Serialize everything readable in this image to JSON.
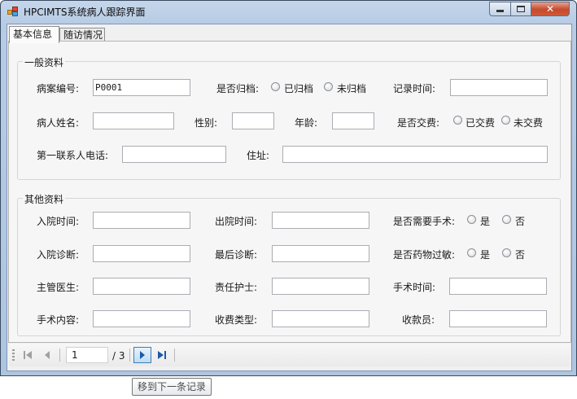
{
  "window": {
    "title": "HPCIMTS系统病人跟踪界面",
    "close_glyph": "✕"
  },
  "tabs": [
    {
      "label": "基本信息",
      "active": true
    },
    {
      "label": "随访情况",
      "active": false
    }
  ],
  "general": {
    "title": "一般资料",
    "case_no_label": "病案编号:",
    "case_no_value": "P0001",
    "archived_label": "是否归档:",
    "archived_yes": "已归档",
    "archived_no": "未归档",
    "record_time_label": "记录时间:",
    "patient_name_label": "病人姓名:",
    "gender_label": "性别:",
    "age_label": "年龄:",
    "paid_label": "是否交费:",
    "paid_yes": "已交费",
    "paid_no": "未交费",
    "contact_phone_label": "第一联系人电话:",
    "address_label": "住址:"
  },
  "other": {
    "title": "其他资料",
    "admission_time_label": "入院时间:",
    "discharge_time_label": "出院时间:",
    "surgery_needed_label": "是否需要手术:",
    "surgery_yes": "是",
    "surgery_no": "否",
    "admission_diag_label": "入院诊断:",
    "final_diag_label": "最后诊断:",
    "allergy_label": "是否药物过敏:",
    "allergy_yes": "是",
    "allergy_no": "否",
    "doctor_label": "主管医生:",
    "nurse_label": "责任护士:",
    "surgery_time_label": "手术时间:",
    "surgery_content_label": "手术内容:",
    "fee_type_label": "收费类型:",
    "cashier_label": "收款员:"
  },
  "navigator": {
    "position": "1",
    "count_label": "/ 3",
    "tooltip": "移到下一条记录"
  },
  "icons": {
    "first": "first-record-icon",
    "prev": "previous-record-icon",
    "next": "next-record-icon",
    "last": "last-record-icon"
  }
}
